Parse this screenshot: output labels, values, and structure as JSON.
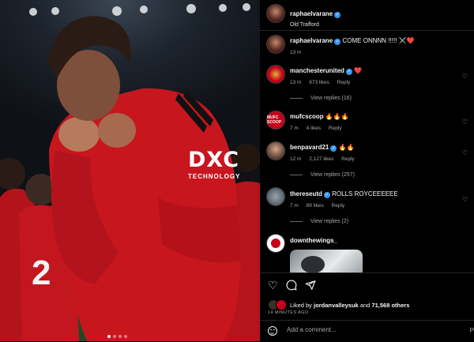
{
  "post": {
    "author": "raphaelvarane",
    "location": "Old Trafford",
    "caption": "COME ONNNN !!!!! ⚔️❤️",
    "caption_time": "13 m",
    "sponsor_logo": "DXC",
    "sponsor_sub": "TECHNOLOGY"
  },
  "comments": [
    {
      "username": "manchesterunited",
      "text": "❤️",
      "time": "13 m",
      "likes": "673 likes",
      "reply": "Reply",
      "view_replies": "View replies (16)"
    },
    {
      "username": "mufcscoop",
      "text": "🔥🔥🔥",
      "time": "7 m",
      "likes": "4 likes",
      "reply": "Reply",
      "avatar_text": "MUFC SCOOP"
    },
    {
      "username": "benpavard21",
      "text": "🔥🔥",
      "time": "12 m",
      "likes": "2,127 likes",
      "reply": "Reply",
      "view_replies": "View replies (257)"
    },
    {
      "username": "thereseutd",
      "text": "ROLLS ROYCEEEEEE",
      "time": "7 m",
      "likes": "89 likes",
      "reply": "Reply",
      "view_replies": "View replies (2)"
    },
    {
      "username": "downthewings_"
    }
  ],
  "likes_line": {
    "prefix": "Liked by",
    "user": "jordanvalleysuk",
    "and": "and",
    "count": "71,568 others"
  },
  "time_ago": "14 MINUTES AGO",
  "add_comment": {
    "placeholder": "Add a comment...",
    "post_label": "P"
  },
  "icons": {
    "heart": "heart-icon",
    "comment": "comment-icon",
    "share": "share-icon",
    "emoji": "emoji-icon"
  }
}
